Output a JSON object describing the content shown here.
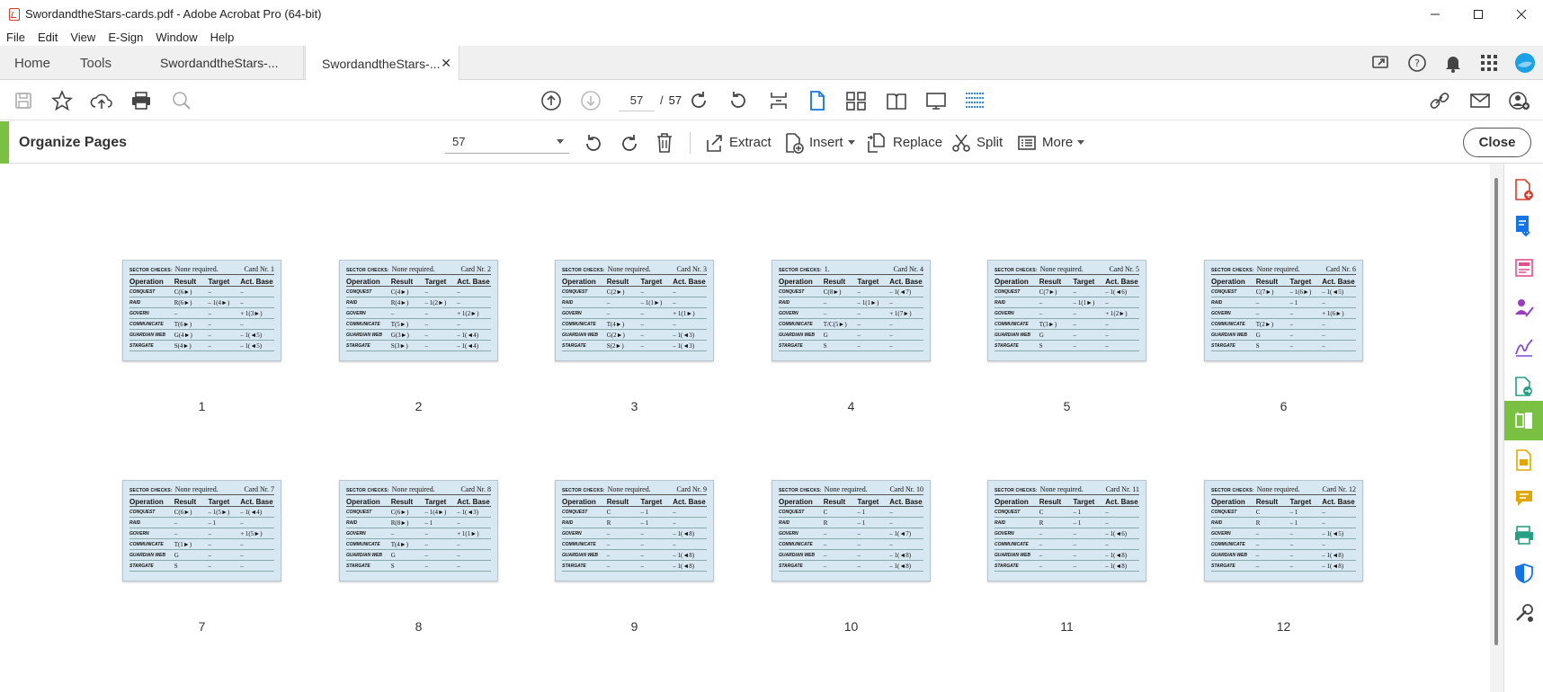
{
  "window": {
    "title": "SwordandtheStars-cards.pdf - Adobe Acrobat Pro (64-bit)"
  },
  "menu": [
    "File",
    "Edit",
    "View",
    "E-Sign",
    "Window",
    "Help"
  ],
  "tabs": {
    "home": "Home",
    "tools": "Tools",
    "doc1": "SwordandtheStars-...",
    "doc2": "SwordandtheStars-..."
  },
  "toolbar": {
    "current_page": "57",
    "separator": "/",
    "total_pages": "57"
  },
  "organize": {
    "title": "Organize Pages",
    "page_select": "57",
    "extract": "Extract",
    "insert": "Insert",
    "replace": "Replace",
    "split": "Split",
    "more": "More",
    "close": "Close"
  },
  "card_columns": [
    "Operation",
    "Result",
    "Target",
    "Act. Base"
  ],
  "card_header_label": "SECTOR CHECKS:",
  "row_labels": [
    "CONQUEST",
    "RAID",
    "GOVERN",
    "COMMUNICATE",
    "GUARDIAN WEB",
    "STARGATE"
  ],
  "pages": [
    {
      "num": "1",
      "note": "None required.",
      "card": "Card Nr. 1",
      "rows": [
        [
          "C(6►)",
          "–",
          "–"
        ],
        [
          "R(6►)",
          "– 1(4►)",
          "–"
        ],
        [
          "–",
          "–",
          "+ 1(3►)"
        ],
        [
          "T(6►)",
          "–",
          "–"
        ],
        [
          "G(4►)",
          "–",
          "– 1(◄5)"
        ],
        [
          "S(4►)",
          "–",
          "– 1(◄5)"
        ]
      ]
    },
    {
      "num": "2",
      "note": "None required.",
      "card": "Card Nr. 2",
      "rows": [
        [
          "C(4►)",
          "–",
          "–"
        ],
        [
          "R(4►)",
          "– 1(2►)",
          "–"
        ],
        [
          "–",
          "–",
          "+ 1(2►)"
        ],
        [
          "T(5►)",
          "–",
          "–"
        ],
        [
          "G(3►)",
          "–",
          "– 1(◄4)"
        ],
        [
          "S(3►)",
          "–",
          "– 1(◄4)"
        ]
      ]
    },
    {
      "num": "3",
      "note": "None required.",
      "card": "Card Nr. 3",
      "rows": [
        [
          "C(2►)",
          "–",
          "–"
        ],
        [
          "–",
          "– 1(1►)",
          "–"
        ],
        [
          "–",
          "–",
          "+ 1(1►)"
        ],
        [
          "T(4►)",
          "–",
          "–"
        ],
        [
          "G(2►)",
          "–",
          "– 1(◄3)"
        ],
        [
          "S(2►)",
          "–",
          "– 1(◄3)"
        ]
      ]
    },
    {
      "num": "4",
      "note": "1.",
      "card": "Card Nr. 4",
      "rows": [
        [
          "C(8►)",
          "–",
          "– 1(◄7)"
        ],
        [
          "–",
          "– 1(1►)",
          "–"
        ],
        [
          "–",
          "–",
          "+ 1(7►)"
        ],
        [
          "T/C(5►)",
          "–",
          "–"
        ],
        [
          "G",
          "–",
          "–"
        ],
        [
          "S",
          "–",
          "–"
        ]
      ]
    },
    {
      "num": "5",
      "note": "None required.",
      "card": "Card Nr. 5",
      "rows": [
        [
          "C(7►)",
          "–",
          "– 1(◄6)"
        ],
        [
          "–",
          "– 1(1►)",
          "–"
        ],
        [
          "–",
          "–",
          "+ 1(2►)"
        ],
        [
          "T(3►)",
          "–",
          "–"
        ],
        [
          "G",
          "–",
          "–"
        ],
        [
          "S",
          "–",
          "–"
        ]
      ]
    },
    {
      "num": "6",
      "note": "None required.",
      "card": "Card Nr. 6",
      "rows": [
        [
          "C(7►)",
          "– 1(6►)",
          "– 1(◄5)"
        ],
        [
          "–",
          "– 1",
          "–"
        ],
        [
          "–",
          "–",
          "+ 1(6►)"
        ],
        [
          "T(2►)",
          "–",
          "–"
        ],
        [
          "G",
          "–",
          "–"
        ],
        [
          "S",
          "–",
          "–"
        ]
      ]
    },
    {
      "num": "7",
      "note": "None required.",
      "card": "Card Nr. 7",
      "rows": [
        [
          "C(6►)",
          "– 1(5►)",
          "– 1(◄4)"
        ],
        [
          "–",
          "– 1",
          "–"
        ],
        [
          "–",
          "–",
          "+ 1(5►)"
        ],
        [
          "T(1►)",
          "–",
          "–"
        ],
        [
          "G",
          "–",
          "–"
        ],
        [
          "S",
          "–",
          "–"
        ]
      ]
    },
    {
      "num": "8",
      "note": "None required.",
      "card": "Card Nr. 8",
      "rows": [
        [
          "C(6►)",
          "– 1(4►)",
          "– 1(◄3)"
        ],
        [
          "R(8►)",
          "– 1",
          "–"
        ],
        [
          "–",
          "–",
          "+ 1(1►)"
        ],
        [
          "T(4►)",
          "–",
          "–"
        ],
        [
          "G",
          "–",
          "–"
        ],
        [
          "S",
          "–",
          "–"
        ]
      ]
    },
    {
      "num": "9",
      "note": "None required.",
      "card": "Card Nr. 9",
      "rows": [
        [
          "C",
          "– 1",
          "–"
        ],
        [
          "R",
          "– 1",
          "–"
        ],
        [
          "–",
          "–",
          "– 1(◄8)"
        ],
        [
          "–",
          "–",
          "–"
        ],
        [
          "–",
          "–",
          "– 1(◄8)"
        ],
        [
          "–",
          "–",
          "– 1(◄8)"
        ]
      ]
    },
    {
      "num": "10",
      "note": "None required.",
      "card": "Card Nr. 10",
      "rows": [
        [
          "C",
          "– 1",
          "–"
        ],
        [
          "R",
          "– 1",
          "–"
        ],
        [
          "–",
          "–",
          "– 1(◄7)"
        ],
        [
          "–",
          "–",
          "–"
        ],
        [
          "–",
          "–",
          "– 1(◄8)"
        ],
        [
          "–",
          "–",
          "– 1(◄8)"
        ]
      ]
    },
    {
      "num": "11",
      "note": "None required.",
      "card": "Card Nr. 11",
      "rows": [
        [
          "C",
          "– 1",
          "–"
        ],
        [
          "R",
          "– 1",
          "–"
        ],
        [
          "–",
          "–",
          "– 1(◄6)"
        ],
        [
          "–",
          "–",
          "–"
        ],
        [
          "–",
          "–",
          "– 1(◄8)"
        ],
        [
          "–",
          "–",
          "– 1(◄8)"
        ]
      ]
    },
    {
      "num": "12",
      "note": "None required.",
      "card": "Card Nr. 12",
      "rows": [
        [
          "C",
          "– 1",
          "–"
        ],
        [
          "R",
          "– 1",
          "–"
        ],
        [
          "–",
          "–",
          "– 1(◄5)"
        ],
        [
          "–",
          "–",
          "–"
        ],
        [
          "–",
          "–",
          "– 1(◄8)"
        ],
        [
          "–",
          "–",
          "– 1(◄8)"
        ]
      ]
    }
  ],
  "colors": {
    "accent_green": "#7ac143",
    "acrobat_red": "#d83b2b",
    "nav_blue": "#1473e6"
  }
}
